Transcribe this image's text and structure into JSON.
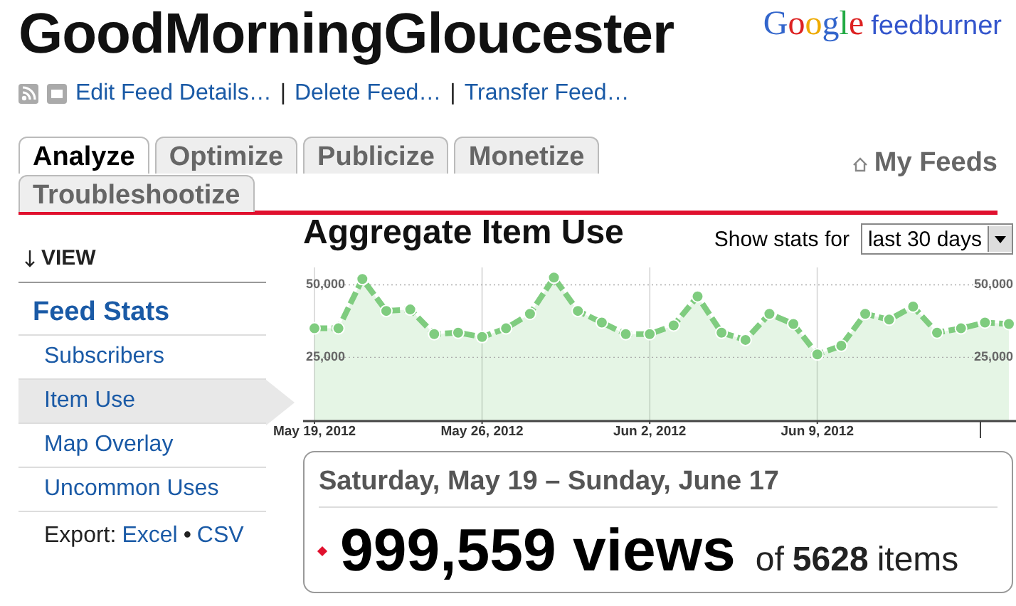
{
  "header": {
    "title": "GoodMorningGloucester",
    "logo": {
      "brand": "Google",
      "product": "feedburner"
    }
  },
  "feed_actions": [
    "Edit Feed Details…",
    "Delete Feed…",
    "Transfer Feed…"
  ],
  "action_separator": "|",
  "tabs": [
    {
      "label": "Analyze",
      "selected": true
    },
    {
      "label": "Optimize",
      "selected": false
    },
    {
      "label": "Publicize",
      "selected": false
    },
    {
      "label": "Monetize",
      "selected": false
    },
    {
      "label": "Troubleshootize",
      "selected": false
    }
  ],
  "my_feeds": "My Feeds",
  "sidebar": {
    "heading": "VIEW",
    "section": "Feed Stats",
    "items": [
      {
        "label": "Subscribers",
        "selected": false
      },
      {
        "label": "Item Use",
        "selected": true
      },
      {
        "label": "Map Overlay",
        "selected": false
      },
      {
        "label": "Uncommon Uses",
        "selected": false
      }
    ],
    "export_label": "Export:",
    "export_links": [
      "Excel",
      "CSV"
    ],
    "export_separator": "•"
  },
  "main": {
    "title": "Aggregate Item Use",
    "range_label": "Show stats for",
    "range_value": "last 30 days",
    "chart_data": {
      "type": "area",
      "categories": [
        "May 19, 2012",
        null,
        null,
        null,
        null,
        null,
        null,
        "May 26, 2012",
        null,
        null,
        null,
        null,
        null,
        null,
        "Jun 2, 2012",
        null,
        null,
        null,
        null,
        null,
        null,
        "Jun 9, 2012",
        null,
        null,
        null,
        null,
        null,
        null,
        null,
        null
      ],
      "series": [
        {
          "color": "#7fcc7f",
          "values": [
            35000,
            35000,
            52000,
            41000,
            41500,
            33000,
            33500,
            32000,
            35000,
            40000,
            52500,
            41000,
            37000,
            33000,
            33000,
            36000,
            46000,
            33500,
            31000,
            40000,
            36500,
            26000,
            29000,
            40000,
            38000,
            42500,
            33500,
            35000,
            37000,
            36500
          ]
        }
      ],
      "ylim": [
        3000,
        56000
      ],
      "yticks": [
        {
          "value": 25000,
          "label": "25,000"
        },
        {
          "value": 50000,
          "label": "50,000"
        }
      ],
      "grid": true
    }
  },
  "summary": {
    "date_range": "Saturday, May 19 – Sunday, June 17",
    "views": "999,559 views",
    "of": "of",
    "items_count": "5628",
    "items": "items"
  }
}
